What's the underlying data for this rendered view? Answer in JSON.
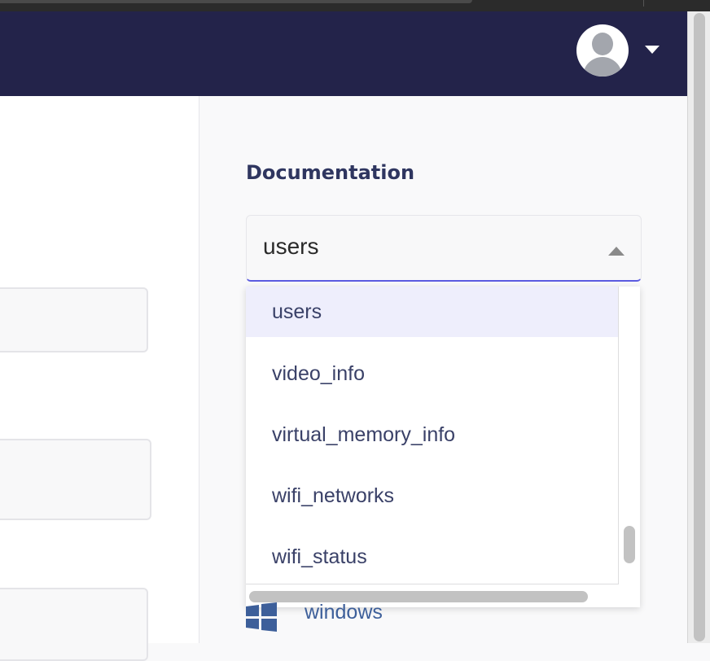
{
  "header": {
    "avatar_icon": "user-avatar-icon",
    "menu_caret_icon": "caret-down-icon",
    "colors": {
      "background": "#23234a"
    }
  },
  "documentation": {
    "title": "Documentation",
    "select": {
      "value": "users",
      "arrow_icon": "caret-up-icon",
      "accent_color": "#5b5be0"
    },
    "options": [
      {
        "label": "users",
        "active": true
      },
      {
        "label": "video_info",
        "active": false
      },
      {
        "label": "virtual_memory_info",
        "active": false
      },
      {
        "label": "wifi_networks",
        "active": false
      },
      {
        "label": "wifi_status",
        "active": false
      }
    ],
    "below_item": {
      "label": "windows",
      "icon": "windows-logo-icon"
    }
  }
}
